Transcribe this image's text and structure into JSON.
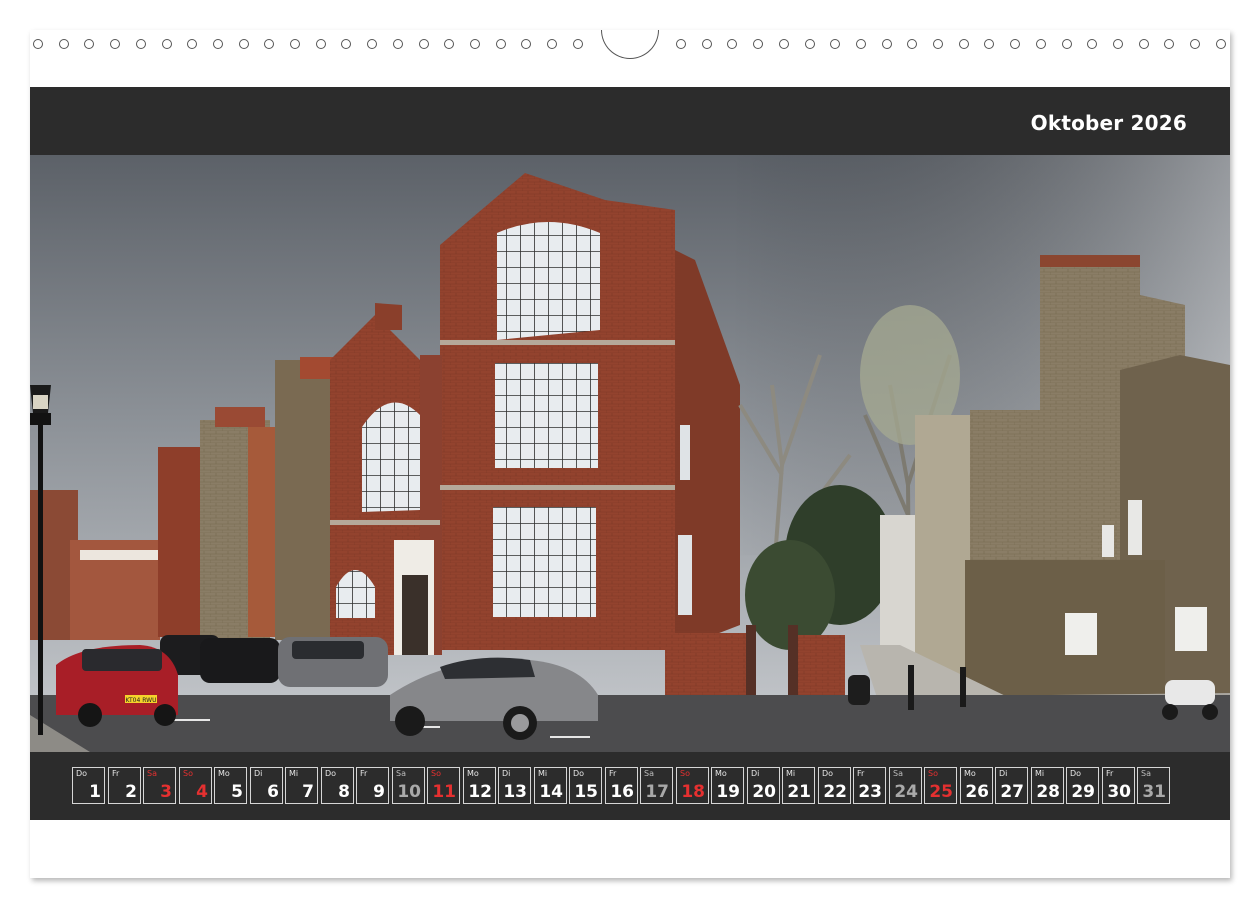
{
  "calendar": {
    "month_title": "Oktober 2026",
    "days": [
      {
        "dow": "Do",
        "num": "1",
        "kind": "weekday"
      },
      {
        "dow": "Fr",
        "num": "2",
        "kind": "weekday"
      },
      {
        "dow": "Sa",
        "num": "3",
        "kind": "holiday"
      },
      {
        "dow": "So",
        "num": "4",
        "kind": "sunday"
      },
      {
        "dow": "Mo",
        "num": "5",
        "kind": "weekday"
      },
      {
        "dow": "Di",
        "num": "6",
        "kind": "weekday"
      },
      {
        "dow": "Mi",
        "num": "7",
        "kind": "weekday"
      },
      {
        "dow": "Do",
        "num": "8",
        "kind": "weekday"
      },
      {
        "dow": "Fr",
        "num": "9",
        "kind": "weekday"
      },
      {
        "dow": "Sa",
        "num": "10",
        "kind": "saturday"
      },
      {
        "dow": "So",
        "num": "11",
        "kind": "sunday"
      },
      {
        "dow": "Mo",
        "num": "12",
        "kind": "weekday"
      },
      {
        "dow": "Di",
        "num": "13",
        "kind": "weekday"
      },
      {
        "dow": "Mi",
        "num": "14",
        "kind": "weekday"
      },
      {
        "dow": "Do",
        "num": "15",
        "kind": "weekday"
      },
      {
        "dow": "Fr",
        "num": "16",
        "kind": "weekday"
      },
      {
        "dow": "Sa",
        "num": "17",
        "kind": "saturday"
      },
      {
        "dow": "So",
        "num": "18",
        "kind": "sunday"
      },
      {
        "dow": "Mo",
        "num": "19",
        "kind": "weekday"
      },
      {
        "dow": "Di",
        "num": "20",
        "kind": "weekday"
      },
      {
        "dow": "Mi",
        "num": "21",
        "kind": "weekday"
      },
      {
        "dow": "Do",
        "num": "22",
        "kind": "weekday"
      },
      {
        "dow": "Fr",
        "num": "23",
        "kind": "weekday"
      },
      {
        "dow": "Sa",
        "num": "24",
        "kind": "saturday"
      },
      {
        "dow": "So",
        "num": "25",
        "kind": "sunday"
      },
      {
        "dow": "Mo",
        "num": "26",
        "kind": "weekday"
      },
      {
        "dow": "Di",
        "num": "27",
        "kind": "weekday"
      },
      {
        "dow": "Mi",
        "num": "28",
        "kind": "weekday"
      },
      {
        "dow": "Do",
        "num": "29",
        "kind": "weekday"
      },
      {
        "dow": "Fr",
        "num": "30",
        "kind": "weekday"
      },
      {
        "dow": "Sa",
        "num": "31",
        "kind": "saturday"
      }
    ]
  },
  "photo": {
    "car_plate": "KT04 RWU"
  },
  "colors": {
    "band": "#2c2c2c",
    "sunday": "#e53030",
    "saturday": "#a9a9a9",
    "weekday": "#ffffff"
  }
}
